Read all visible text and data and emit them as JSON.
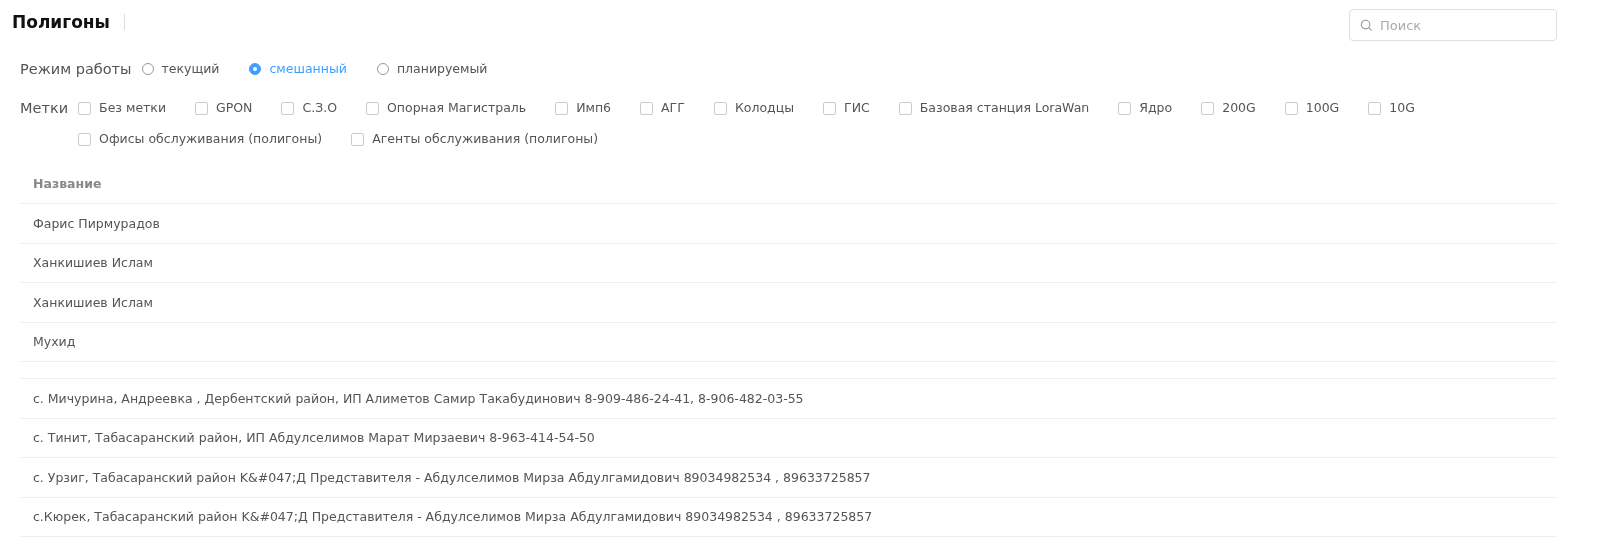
{
  "title": "Полигоны",
  "search": {
    "placeholder": "Поиск"
  },
  "mode": {
    "label": "Режим работы",
    "options": [
      {
        "label": "текущий",
        "selected": false
      },
      {
        "label": "смешанный",
        "selected": true
      },
      {
        "label": "планируемый",
        "selected": false
      }
    ]
  },
  "tags": {
    "label": "Метки",
    "options": [
      {
        "label": "Без метки",
        "checked": false
      },
      {
        "label": "GPON",
        "checked": false
      },
      {
        "label": "С.З.О",
        "checked": false
      },
      {
        "label": "Опорная Магистраль",
        "checked": false
      },
      {
        "label": "Имп6",
        "checked": false
      },
      {
        "label": "АГГ",
        "checked": false
      },
      {
        "label": "Колодцы",
        "checked": false
      },
      {
        "label": "ГИС",
        "checked": false
      },
      {
        "label": "Базовая станция LoraWan",
        "checked": false
      },
      {
        "label": "Ядро",
        "checked": false
      },
      {
        "label": "200G",
        "checked": false
      },
      {
        "label": "100G",
        "checked": false
      },
      {
        "label": "10G",
        "checked": false
      },
      {
        "label": "Офисы обслуживания (полигоны)",
        "checked": false
      },
      {
        "label": "Агенты обслуживания (полигоны)",
        "checked": false
      }
    ]
  },
  "table": {
    "columns": [
      "Название"
    ],
    "rows": [
      {
        "name": "Фарис Пирмурадов"
      },
      {
        "name": "Ханкишиев Ислам"
      },
      {
        "name": "Ханкишиев Ислам"
      },
      {
        "name": "Мухид"
      },
      {},
      {
        "name": "с. Мичурина, Андреевка , Дербентский район, ИП Алиметов Самир Такабудинович 8-909-486-24-41, 8-906-482-03-55"
      },
      {
        "name": "с. Тинит, Табасаранский район, ИП Абдулселимов Марат Мирзаевич 8-963-414-54-50"
      },
      {
        "name": "с. Урзиг, Табасаранский район K&#047;Д Представителя - Абдулселимов Мирза Абдулгамидович 89034982534 , 89633725857"
      },
      {
        "name": "с.Кюрек, Табасаранский район K&#047;Д Представителя - Абдулселимов Мирза Абдулгамидович 89034982534 , 89633725857"
      }
    ]
  }
}
